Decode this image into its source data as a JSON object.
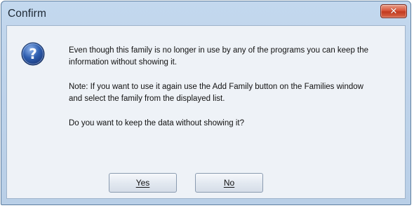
{
  "window": {
    "title": "Confirm",
    "close_icon": "close-icon"
  },
  "dialog": {
    "icon": "question-icon",
    "messages": [
      "Even though this family is no longer in use by any of the programs you can keep the information without showing it.",
      "Note: If you want to use it again use the Add Family button on the Families window and select the family from the displayed list.",
      "Do you want to keep the data without showing it?"
    ]
  },
  "buttons": {
    "yes_label": "Yes",
    "no_label": "No"
  },
  "colors": {
    "frame": "#bed3ea",
    "client": "#eef2f7",
    "close_button": "#c9472b",
    "question_icon": "#2c5aa8"
  }
}
